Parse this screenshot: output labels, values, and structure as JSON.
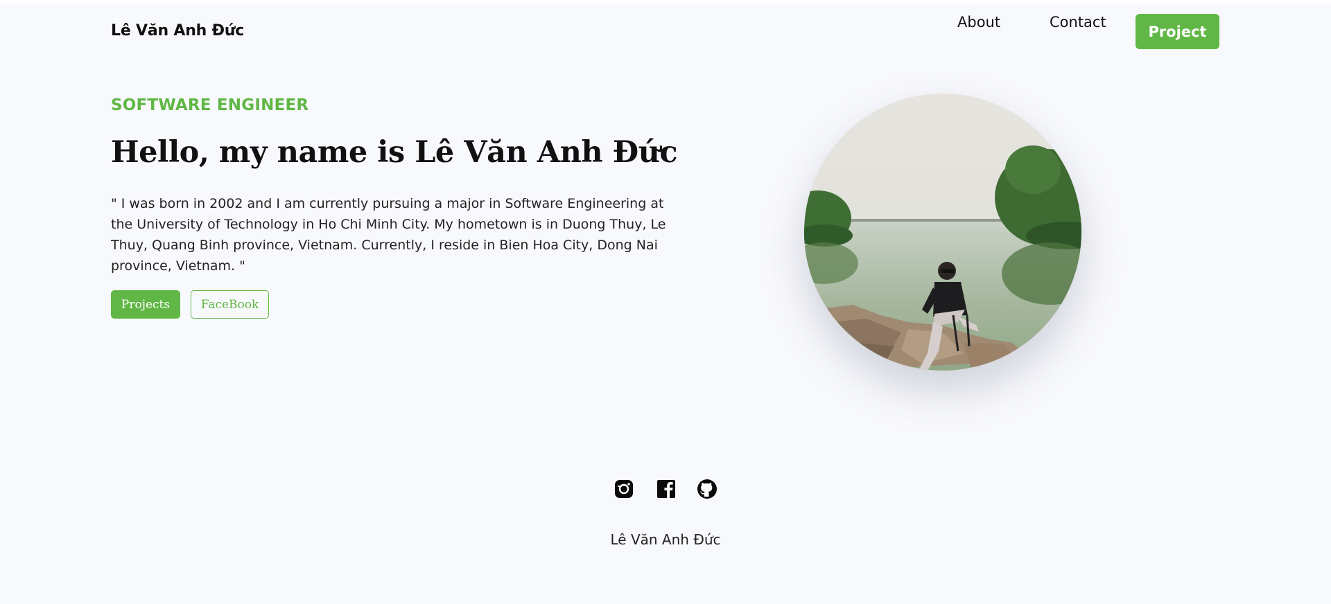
{
  "header": {
    "brand": "Lê Văn Anh Đức",
    "nav": {
      "about": "About",
      "contact": "Contact",
      "project": "Project"
    }
  },
  "hero": {
    "role": "SOFTWARE ENGINEER",
    "headline": "Hello, my name is Lê Văn Anh Đức",
    "bio": "\" I was born in 2002 and I am currently pursuing a major in Software Engineering at the University of Technology in Ho Chi Minh City. My hometown is in Duong Thuy, Le Thuy, Quang Binh province, Vietnam. Currently, I reside in Bien Hoa City, Dong Nai province, Vietnam. \"",
    "buttons": {
      "projects": "Projects",
      "facebook": "FaceBook"
    }
  },
  "footer": {
    "social": [
      "instagram-icon",
      "facebook-icon",
      "github-icon"
    ],
    "name": "Lê Văn Anh Đức"
  },
  "colors": {
    "accent": "#60b745",
    "background": "#f8f9fd",
    "text": "#111111"
  }
}
